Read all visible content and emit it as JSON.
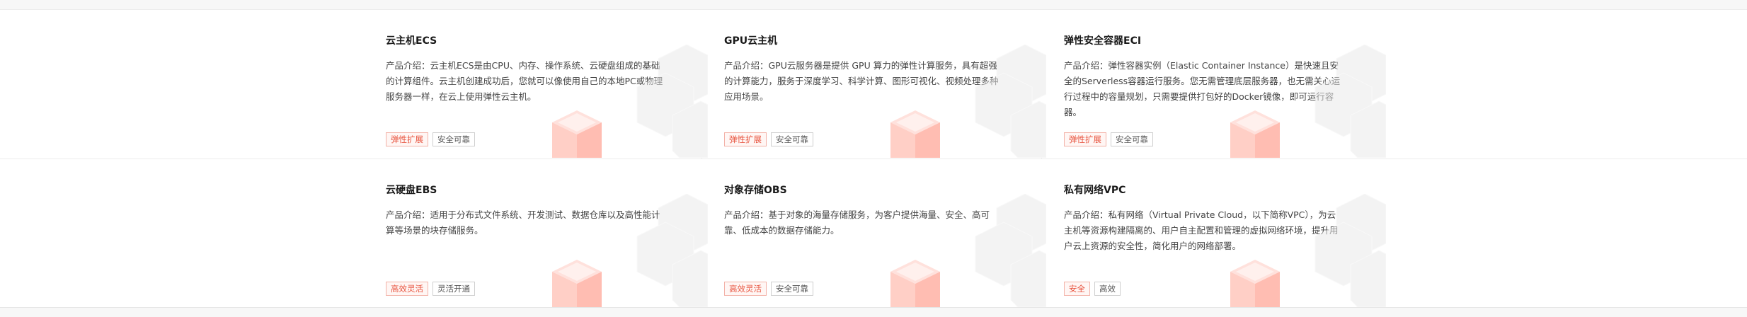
{
  "cards": [
    {
      "title": "云主机ECS",
      "desc": "产品介绍：云主机ECS是由CPU、内存、操作系统、云硬盘组成的基础的计算组件。云主机创建成功后，您就可以像使用自己的本地PC或物理服务器一样，在云上使用弹性云主机。",
      "tags": [
        {
          "label": "弹性扩展",
          "style": "red"
        },
        {
          "label": "安全可靠",
          "style": "gray"
        }
      ]
    },
    {
      "title": "GPU云主机",
      "desc": "产品介绍：GPU云服务器是提供 GPU 算力的弹性计算服务，具有超强的计算能力，服务于深度学习、科学计算、图形可视化、视频处理多种应用场景。",
      "tags": [
        {
          "label": "弹性扩展",
          "style": "red"
        },
        {
          "label": "安全可靠",
          "style": "gray"
        }
      ]
    },
    {
      "title": "弹性安全容器ECI",
      "desc": "产品介绍：弹性容器实例（Elastic Container Instance）是快速且安全的Serverless容器运行服务。您无需管理底层服务器，也无需关心运行过程中的容量规划，只需要提供打包好的Docker镜像，即可运行容器。",
      "tags": [
        {
          "label": "弹性扩展",
          "style": "red"
        },
        {
          "label": "安全可靠",
          "style": "gray"
        }
      ]
    },
    {
      "title": "云硬盘EBS",
      "desc": "产品介绍：适用于分布式文件系统、开发测试、数据仓库以及高性能计算等场景的块存储服务。",
      "tags": [
        {
          "label": "高效灵活",
          "style": "red"
        },
        {
          "label": "灵活开通",
          "style": "gray"
        }
      ]
    },
    {
      "title": "对象存储OBS",
      "desc": "产品介绍：基于对象的海量存储服务，为客户提供海量、安全、高可靠、低成本的数据存储能力。",
      "tags": [
        {
          "label": "高效灵活",
          "style": "red"
        },
        {
          "label": "安全可靠",
          "style": "gray"
        }
      ]
    },
    {
      "title": "私有网络VPC",
      "desc": "产品介绍：私有网络（Virtual Private Cloud，以下简称VPC），为云主机等资源构建隔离的、用户自主配置和管理的虚拟网络环境，提升用户云上资源的安全性，简化用户的网络部署。",
      "tags": [
        {
          "label": "安全",
          "style": "red"
        },
        {
          "label": "高效",
          "style": "gray"
        }
      ]
    }
  ]
}
